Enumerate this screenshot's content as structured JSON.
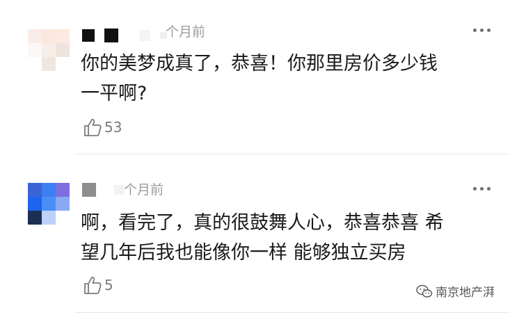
{
  "comments": [
    {
      "time": "个月前",
      "text_line1": "你的美梦成真了，恭喜！你那里房价多少钱",
      "text_line2": "一平啊?",
      "likes": "53"
    },
    {
      "time": "个月前",
      "text_line1": "啊，看完了，真的很鼓舞人心，恭喜恭喜 希",
      "text_line2": "望几年后我也能像你一样 能够独立买房",
      "likes": "5"
    }
  ],
  "watermark": {
    "text": "南京地产湃",
    "icon": "wechat-icon"
  },
  "colors": {
    "text": "#1a1a1a",
    "muted": "#9b9b9b",
    "divider": "#e6e6e6"
  }
}
